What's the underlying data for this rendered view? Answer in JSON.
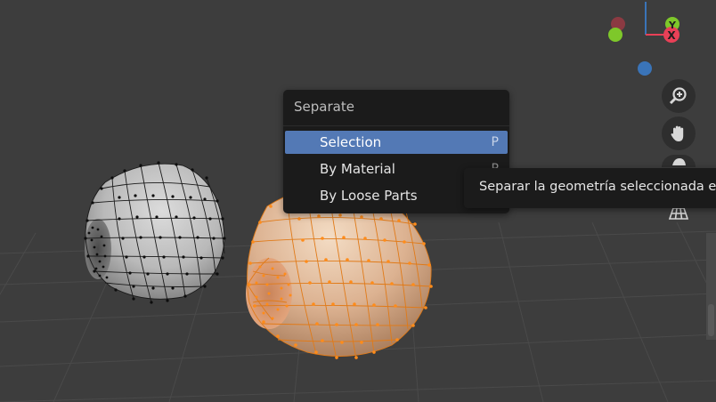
{
  "menu": {
    "title": "Separate",
    "items": [
      {
        "label": "Selection",
        "shortcut": "P"
      },
      {
        "label": "By Material",
        "shortcut": "P"
      },
      {
        "label": "By Loose Parts",
        "shortcut": ""
      }
    ]
  },
  "tooltip": {
    "text": "Separar la geometría seleccionada en"
  },
  "gizmo": {
    "y_axis_label": "Y",
    "x_axis_label": "X"
  },
  "colors": {
    "selection_highlight": "#5379b5",
    "selected_mesh": "#ff8c1a",
    "x_axis": "#e94057",
    "y_axis": "#7ec82a",
    "z_axis": "#3a74b8"
  },
  "nav_icons": [
    "zoom-icon",
    "pan-hand-icon",
    "camera-icon",
    "grid-perspective-icon"
  ]
}
